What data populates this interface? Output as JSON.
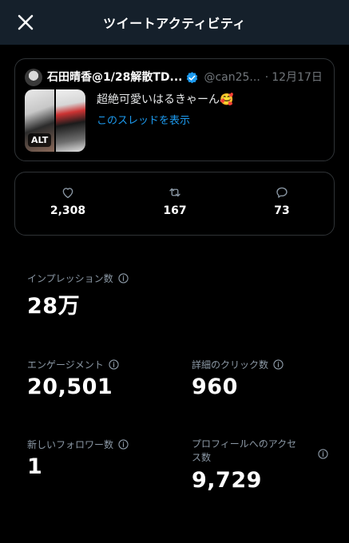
{
  "header": {
    "title": "ツイートアクティビティ"
  },
  "tweet": {
    "author_name": "石田晴香@1/28解散TD...",
    "handle": "@can25...",
    "separator": "·",
    "date": "12月17日",
    "text": "超絶可愛いはるきゃーん🥰",
    "thread_link": "このスレッドを表示",
    "alt_badge": "ALT"
  },
  "engagement": {
    "likes": "2,308",
    "retweets": "167",
    "replies": "73"
  },
  "metrics": {
    "impressions": {
      "label": "インプレッション数",
      "value": "28万"
    },
    "engagements": {
      "label": "エンゲージメント",
      "value": "20,501"
    },
    "detail_clicks": {
      "label": "詳細のクリック数",
      "value": "960"
    },
    "new_followers": {
      "label": "新しいフォロワー数",
      "value": "1"
    },
    "profile_visits": {
      "label": "プロフィールへのアクセス数",
      "value": "9,729"
    }
  },
  "colors": {
    "accent": "#1d9bf0",
    "header_bg": "#15202b",
    "background": "#000000",
    "border": "#2f3336"
  }
}
